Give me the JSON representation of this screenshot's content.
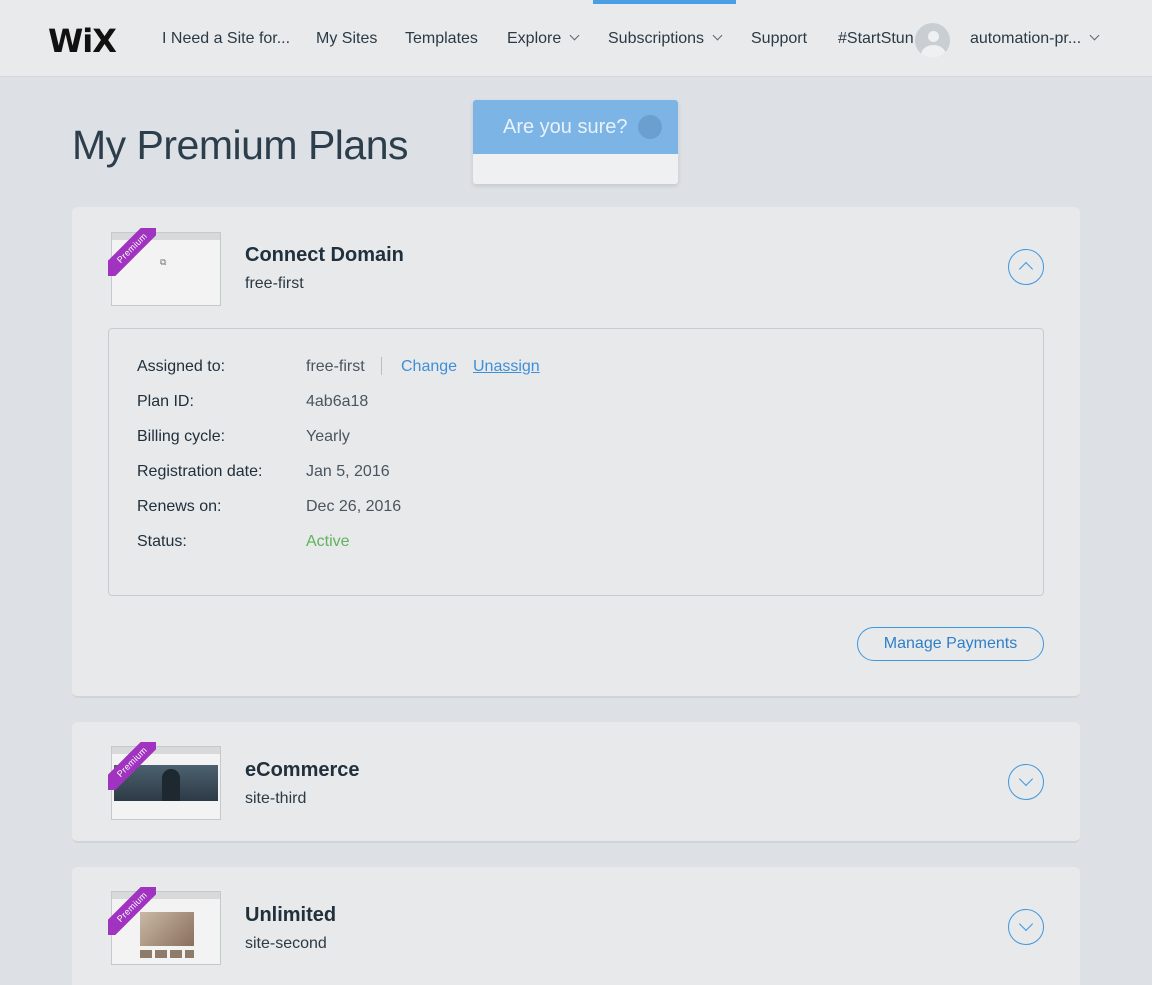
{
  "header": {
    "logo": "WiX",
    "nav": [
      {
        "label": "I Need a Site for..."
      },
      {
        "label": "My Sites"
      },
      {
        "label": "Templates"
      },
      {
        "label": "Explore"
      },
      {
        "label": "Subscriptions"
      },
      {
        "label": "Support"
      },
      {
        "label": "#StartStunning"
      }
    ],
    "user": "automation-pr...",
    "accent_color": "#4a9ee3"
  },
  "page_title": "My Premium Plans",
  "confirm_popup": {
    "title": "Are you sure?"
  },
  "plans": [
    {
      "badge": "Premium",
      "name": "Connect Domain",
      "site": "free-first",
      "expanded": true,
      "details": {
        "assigned_label": "Assigned to:",
        "assigned_value": "free-first",
        "change_link": "Change",
        "unassign_link": "Unassign",
        "plan_id_label": "Plan ID:",
        "plan_id_value": "4ab6a18",
        "billing_label": "Billing cycle:",
        "billing_value": "Yearly",
        "reg_label": "Registration date:",
        "reg_value": "Jan 5, 2016",
        "renews_label": "Renews on:",
        "renews_value": "Dec 26, 2016",
        "status_label": "Status:",
        "status_value": "Active",
        "status_color": "#5fb35c"
      },
      "manage_button": "Manage Payments"
    },
    {
      "badge": "Premium",
      "name": "eCommerce",
      "site": "site-third",
      "expanded": false
    },
    {
      "badge": "Premium",
      "name": "Unlimited",
      "site": "site-second",
      "expanded": false
    }
  ]
}
